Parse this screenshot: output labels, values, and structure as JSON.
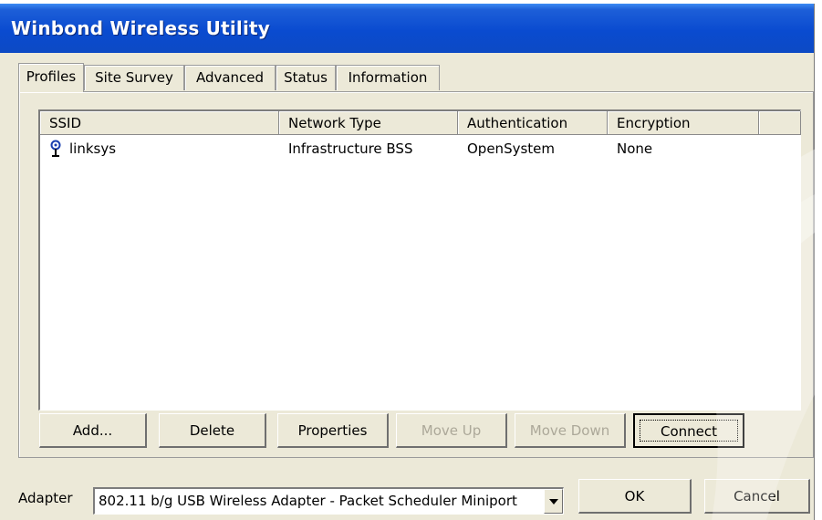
{
  "window": {
    "title": "Winbond Wireless Utility"
  },
  "tabs": [
    {
      "label": "Profiles",
      "active": true
    },
    {
      "label": "Site Survey"
    },
    {
      "label": "Advanced"
    },
    {
      "label": "Status"
    },
    {
      "label": "Information"
    }
  ],
  "profiles_list": {
    "columns": [
      "SSID",
      "Network Type",
      "Authentication",
      "Encryption"
    ],
    "rows": [
      {
        "ssid": "linksys",
        "network_type": "Infrastructure BSS",
        "authentication": "OpenSystem",
        "encryption": "None",
        "icon": "antenna-icon"
      }
    ]
  },
  "buttons": {
    "add": "Add...",
    "delete": "Delete",
    "properties": "Properties",
    "move_up": "Move Up",
    "move_down": "Move Down",
    "connect": "Connect"
  },
  "adapter": {
    "label": "Adapter",
    "selected": "802.11 b/g USB Wireless Adapter - Packet Scheduler Miniport"
  },
  "dialog_buttons": {
    "ok": "OK",
    "cancel": "Cancel"
  },
  "colors": {
    "titlebar": "#0a4bd0",
    "face": "#ece9d8",
    "disabled_text": "#aca899"
  }
}
